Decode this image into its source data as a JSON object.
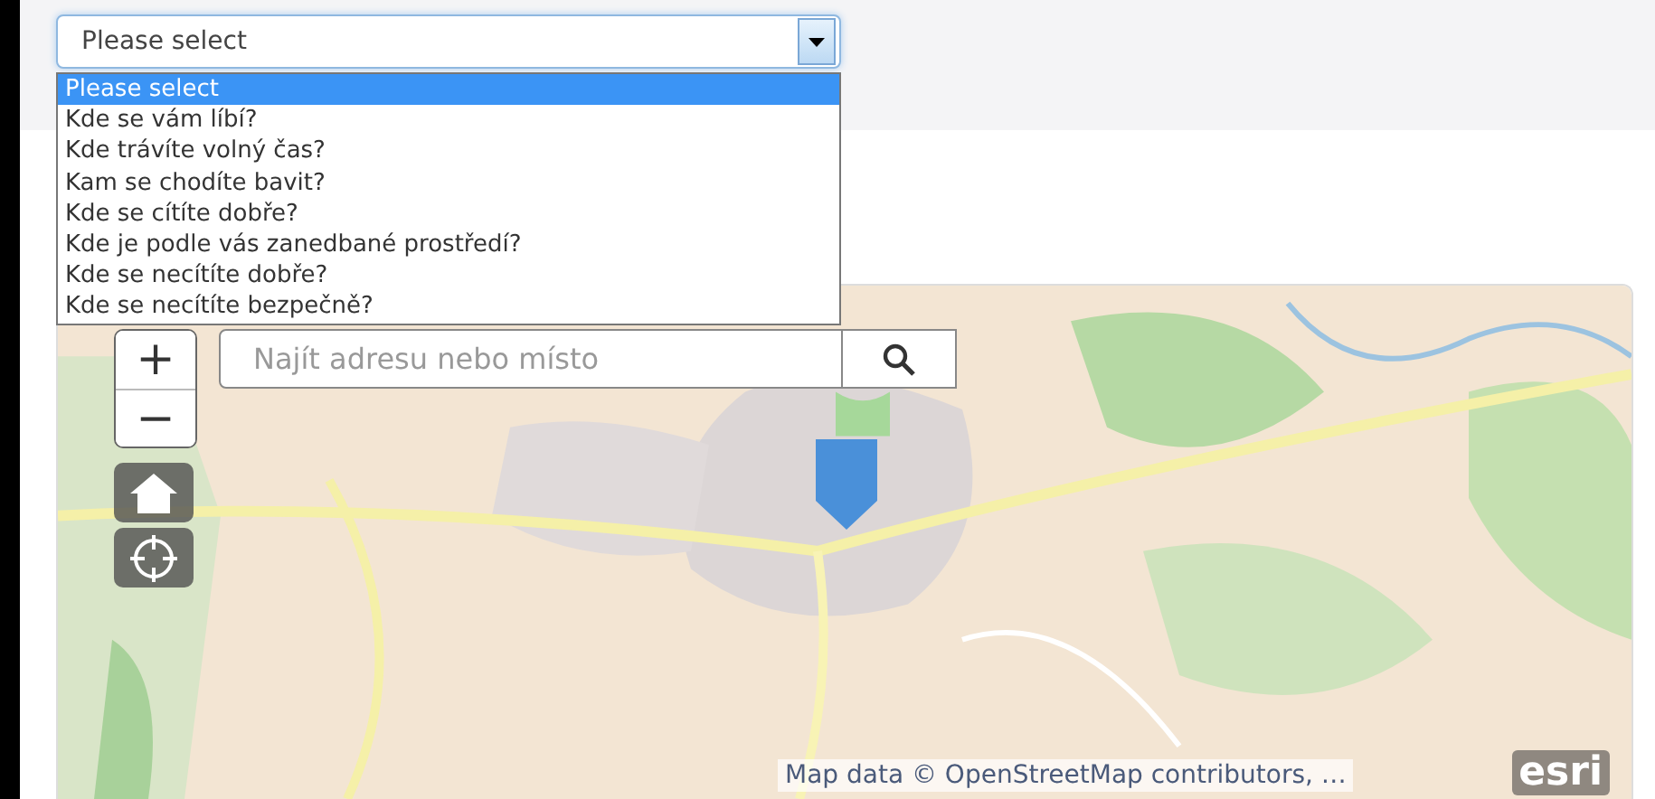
{
  "select": {
    "value": "Please select",
    "expanded": true,
    "options": [
      {
        "label": "Please select",
        "selected": true
      },
      {
        "label": "Kde se vám líbí?",
        "selected": false
      },
      {
        "label": "Kde trávíte volný čas?",
        "selected": false
      },
      {
        "label": "Kam se chodíte bavit?",
        "selected": false
      },
      {
        "label": "Kde se cítíte dobře?",
        "selected": false
      },
      {
        "label": "Kde je podle vás zanedbané prostředí?",
        "selected": false
      },
      {
        "label": "Kde se necítíte dobře?",
        "selected": false
      },
      {
        "label": "Kde se necítíte bezpečně?",
        "selected": false
      }
    ]
  },
  "map": {
    "zoom_in": "+",
    "zoom_out": "−",
    "search": {
      "placeholder": "Najít adresu nebo místo"
    },
    "attribution": "Map data © OpenStreetMap contributors, …",
    "logo": "esri"
  }
}
